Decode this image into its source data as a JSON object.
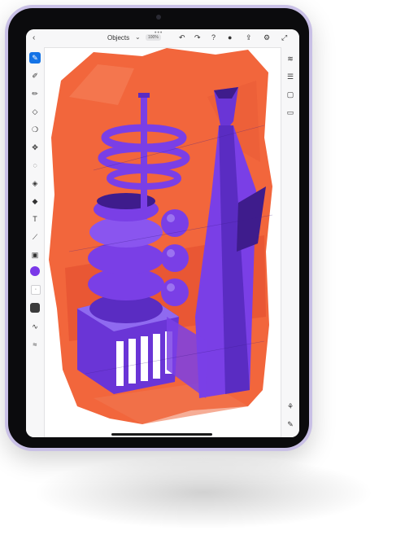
{
  "app": {
    "document_title": "Objects",
    "zoom_level": "100%",
    "more_dots": "•••"
  },
  "icons": {
    "back": "chevron-left-icon",
    "title_dropdown": "chevron-down-icon",
    "undo": "undo-icon",
    "redo": "redo-icon",
    "help": "help-icon",
    "account": "user-icon",
    "share": "share-icon",
    "settings": "gear-icon",
    "expand": "expand-icon"
  },
  "left_tools": [
    {
      "name": "brush-tool",
      "glyph": "✎",
      "active": true
    },
    {
      "name": "vector-brush-tool",
      "glyph": "✐",
      "active": false
    },
    {
      "name": "fill-brush-tool",
      "glyph": "✏",
      "active": false
    },
    {
      "name": "eraser-tool",
      "glyph": "◇",
      "active": false
    },
    {
      "name": "smudge-tool",
      "glyph": "❍",
      "active": false
    },
    {
      "name": "transform-tool",
      "glyph": "✥",
      "active": false
    },
    {
      "name": "lasso-tool",
      "glyph": "◌",
      "active": false
    },
    {
      "name": "paint-bucket-tool",
      "glyph": "◈",
      "active": false
    },
    {
      "name": "fill-tool",
      "glyph": "◆",
      "active": false
    },
    {
      "name": "text-tool",
      "glyph": "T",
      "active": false
    },
    {
      "name": "eyedropper-tool",
      "glyph": "⟋",
      "active": false
    },
    {
      "name": "image-tool",
      "glyph": "▣",
      "active": false
    }
  ],
  "colors": {
    "active_color": "#7a38e8",
    "accent": "#1473e6",
    "background_orange": "#f2663c",
    "purple_object": "#7a3fe6"
  },
  "right_tools": [
    {
      "name": "layers-icon",
      "glyph": "≋"
    },
    {
      "name": "properties-icon",
      "glyph": "☰"
    },
    {
      "name": "canvas-icon",
      "glyph": "▢"
    },
    {
      "name": "comments-icon",
      "glyph": "▭"
    }
  ]
}
